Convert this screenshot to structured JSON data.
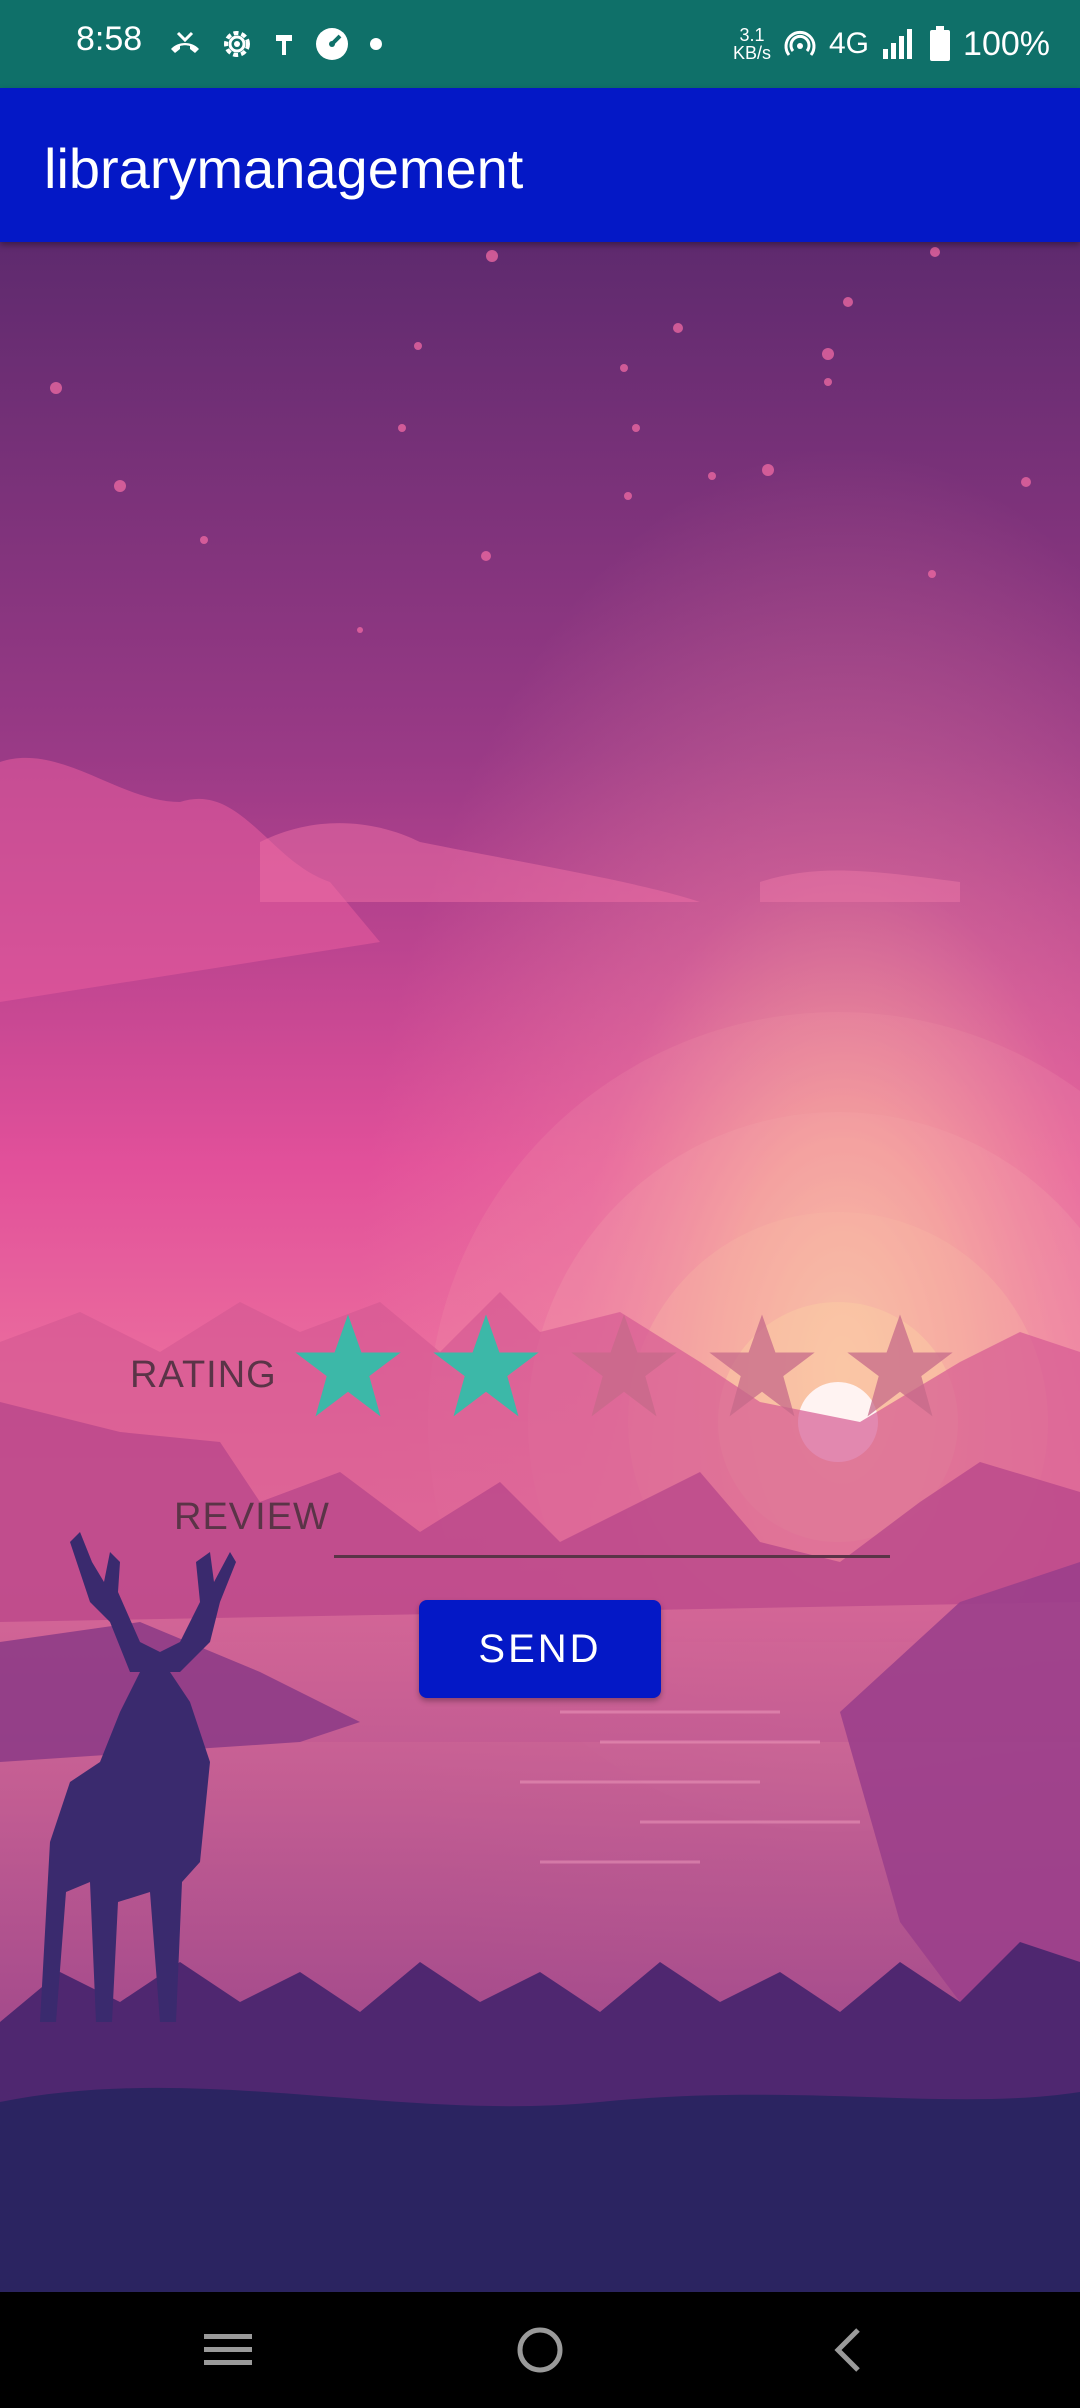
{
  "status_bar": {
    "time": "8:58",
    "left_icons": [
      "missed-call-icon",
      "settings-icon",
      "usb-icon",
      "speedometer-icon",
      "dot-icon"
    ],
    "net_speed_value": "3.1",
    "net_speed_unit": "KB/s",
    "network": "4G",
    "battery": "100%"
  },
  "app_bar": {
    "title": "librarymanagement"
  },
  "form": {
    "rating_label": "RATING",
    "rating_value": 2,
    "rating_max": 5,
    "review_label": "REVIEW",
    "review_value": "",
    "send_label": "SEND"
  },
  "colors": {
    "status_bar": "#0f7069",
    "app_bar": "#0418c6",
    "button": "#0418c6",
    "star_filled": "#3cb8a8",
    "star_empty": "#c66a8a"
  },
  "nav_bar": {
    "buttons": [
      "menu-icon",
      "home-icon",
      "back-icon"
    ]
  }
}
